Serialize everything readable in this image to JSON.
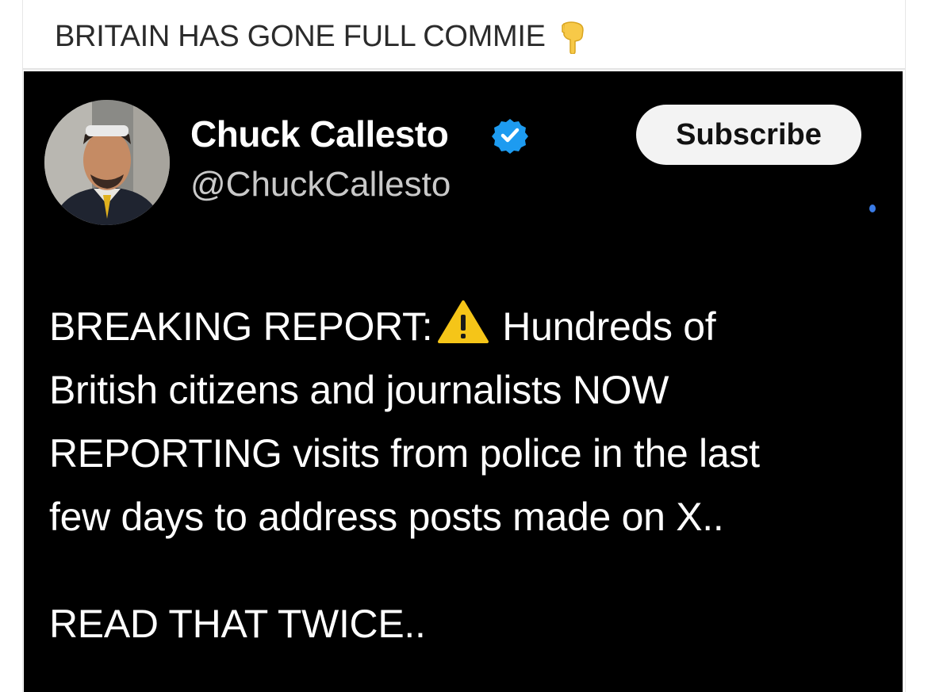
{
  "post": {
    "title": "BRITAIN HAS GONE FULL COMMIE",
    "title_emoji": "pointing-down-icon"
  },
  "tweet": {
    "author_name": "Chuck Callesto",
    "handle": "@ChuckCallesto",
    "verified": true,
    "subscribe_label": "Subscribe",
    "body_lines": [
      {
        "before": "BREAKING REPORT:",
        "icon": "warning-icon",
        "after": "Hundreds of"
      },
      {
        "text": "British citizens and journalists NOW"
      },
      {
        "text": "REPORTING visits from police in the last"
      },
      {
        "text": "few days to address posts made on X.."
      }
    ],
    "closing": "READ THAT TWICE.."
  },
  "colors": {
    "tweet_background": "#000000",
    "verified_badge": "#1d9bf0",
    "warning": "#f5c518",
    "subscribe_bg": "#f3f3f3"
  }
}
